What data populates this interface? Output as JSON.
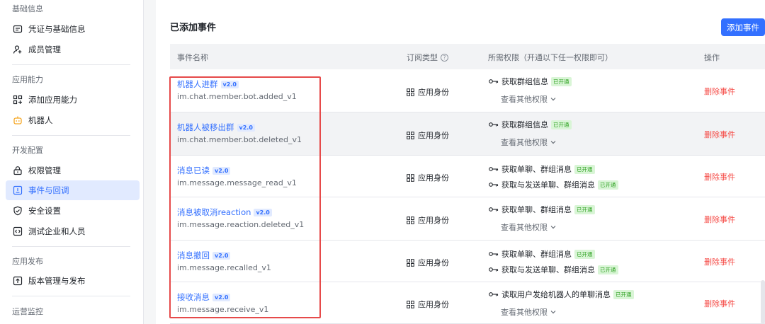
{
  "sidebar": {
    "sections": [
      {
        "title": "基础信息",
        "items": [
          {
            "label": "凭证与基础信息",
            "icon": "id-card-icon",
            "active": false
          },
          {
            "label": "成员管理",
            "icon": "user-add-icon",
            "active": false
          }
        ]
      },
      {
        "title": "应用能力",
        "items": [
          {
            "label": "添加应用能力",
            "icon": "grid-add-icon",
            "active": false
          },
          {
            "label": "机器人",
            "icon": "robot-icon",
            "active": false
          }
        ]
      },
      {
        "title": "开发配置",
        "items": [
          {
            "label": "权限管理",
            "icon": "lock-icon",
            "active": false
          },
          {
            "label": "事件与回调",
            "icon": "event-icon",
            "active": true
          },
          {
            "label": "安全设置",
            "icon": "shield-icon",
            "active": false
          },
          {
            "label": "测试企业和人员",
            "icon": "code-icon",
            "active": false
          }
        ]
      },
      {
        "title": "应用发布",
        "items": [
          {
            "label": "版本管理与发布",
            "icon": "upload-icon",
            "active": false
          }
        ]
      },
      {
        "title": "运营监控",
        "items": []
      }
    ]
  },
  "main": {
    "title": "已添加事件",
    "add_button": "添加事件",
    "columns": {
      "name": "事件名称",
      "type": "订阅类型",
      "perm": "所需权限（开通以下任一权限即可）",
      "action": "操作"
    },
    "rows": [
      {
        "name": "机器人进群",
        "version": "v2.0",
        "id": "im.chat.member.bot.added_v1",
        "type": "应用身份",
        "perms": [
          {
            "label": "获取群组信息",
            "badge": "已开通"
          }
        ],
        "more": "查看其他权限",
        "action": "删除事件",
        "hover": false
      },
      {
        "name": "机器人被移出群",
        "version": "v2.0",
        "id": "im.chat.member.bot.deleted_v1",
        "type": "应用身份",
        "perms": [
          {
            "label": "获取群组信息",
            "badge": "已开通"
          }
        ],
        "more": "查看其他权限",
        "action": "删除事件",
        "hover": true
      },
      {
        "name": "消息已读",
        "version": "v2.0",
        "id": "im.message.message_read_v1",
        "type": "应用身份",
        "perms": [
          {
            "label": "获取单聊、群组消息",
            "badge": "已开通"
          },
          {
            "label": "获取与发送单聊、群组消息",
            "badge": "已开通"
          }
        ],
        "more": "",
        "action": "删除事件",
        "hover": false
      },
      {
        "name": "消息被取消reaction",
        "version": "v2.0",
        "id": "im.message.reaction.deleted_v1",
        "type": "应用身份",
        "perms": [
          {
            "label": "获取单聊、群组消息",
            "badge": "已开通"
          }
        ],
        "more": "查看其他权限",
        "action": "删除事件",
        "hover": false
      },
      {
        "name": "消息撤回",
        "version": "v2.0",
        "id": "im.message.recalled_v1",
        "type": "应用身份",
        "perms": [
          {
            "label": "获取单聊、群组消息",
            "badge": "已开通"
          },
          {
            "label": "获取与发送单聊、群组消息",
            "badge": "已开通"
          }
        ],
        "more": "",
        "action": "删除事件",
        "hover": false
      },
      {
        "name": "接收消息",
        "version": "v2.0",
        "id": "im.message.receive_v1",
        "type": "应用身份",
        "perms": [
          {
            "label": "读取用户发给机器人的单聊消息",
            "badge": "已开通"
          }
        ],
        "more": "查看其他权限",
        "action": "删除事件",
        "hover": false
      }
    ]
  },
  "colors": {
    "accent": "#3370ff",
    "danger": "#f54a45",
    "success": "#2ea121",
    "highlight": "#e64a4a"
  }
}
